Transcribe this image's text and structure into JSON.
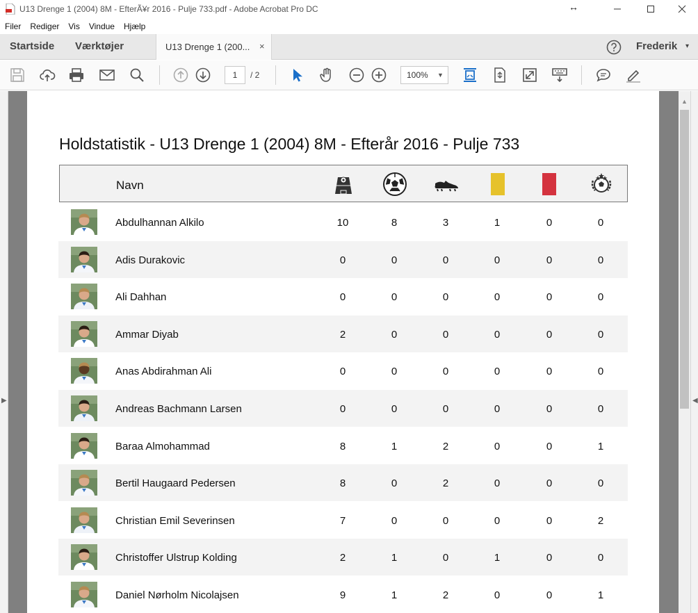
{
  "window": {
    "title": "U13 Drenge 1 (2004) 8M - EfterÃ¥r 2016 - Pulje 733.pdf - Adobe Acrobat Pro DC",
    "resize_glyph": "↔"
  },
  "menu": [
    "Filer",
    "Rediger",
    "Vis",
    "Vindue",
    "Hjælp"
  ],
  "tabs": {
    "home": "Startside",
    "tools": "Værktøjer",
    "document": "U13 Drenge 1 (200...",
    "close": "×"
  },
  "user": {
    "name": "Frederik",
    "caret": "▾"
  },
  "toolbar": {
    "page_current": "1",
    "page_total": "/ 2",
    "zoom": "100%",
    "zoom_caret": "▼"
  },
  "document": {
    "title": "Holdstatistik - U13 Drenge 1 (2004) 8M - Efterår 2016 - Pulje 733",
    "column_header_name": "Navn",
    "stat_icons": [
      "matches-pitch-icon",
      "goal-ball-icon",
      "assist-boot-icon",
      "yellow-card-icon",
      "red-card-icon",
      "player-of-the-match-icon"
    ],
    "colors": {
      "yellow_card": "#e6c22b",
      "red_card": "#d4333f",
      "accent_blue": "#1a6fc9"
    },
    "rows": [
      {
        "name": "Abdulhannan Alkilo",
        "stats": [
          "10",
          "8",
          "3",
          "1",
          "0",
          "0"
        ]
      },
      {
        "name": "Adis Durakovic",
        "stats": [
          "0",
          "0",
          "0",
          "0",
          "0",
          "0"
        ]
      },
      {
        "name": "Ali Dahhan",
        "stats": [
          "0",
          "0",
          "0",
          "0",
          "0",
          "0"
        ]
      },
      {
        "name": "Ammar Diyab",
        "stats": [
          "2",
          "0",
          "0",
          "0",
          "0",
          "0"
        ]
      },
      {
        "name": "Anas Abdirahman Ali",
        "stats": [
          "0",
          "0",
          "0",
          "0",
          "0",
          "0"
        ]
      },
      {
        "name": "Andreas Bachmann Larsen",
        "stats": [
          "0",
          "0",
          "0",
          "0",
          "0",
          "0"
        ]
      },
      {
        "name": "Baraa Almohammad",
        "stats": [
          "8",
          "1",
          "2",
          "0",
          "0",
          "1"
        ]
      },
      {
        "name": "Bertil Haugaard Pedersen",
        "stats": [
          "8",
          "0",
          "2",
          "0",
          "0",
          "0"
        ]
      },
      {
        "name": "Christian Emil Severinsen",
        "stats": [
          "7",
          "0",
          "0",
          "0",
          "0",
          "2"
        ]
      },
      {
        "name": "Christoffer Ulstrup Kolding",
        "stats": [
          "2",
          "1",
          "0",
          "1",
          "0",
          "0"
        ]
      },
      {
        "name": "Daniel Nørholm Nicolajsen",
        "stats": [
          "9",
          "1",
          "2",
          "0",
          "0",
          "1"
        ]
      }
    ]
  }
}
